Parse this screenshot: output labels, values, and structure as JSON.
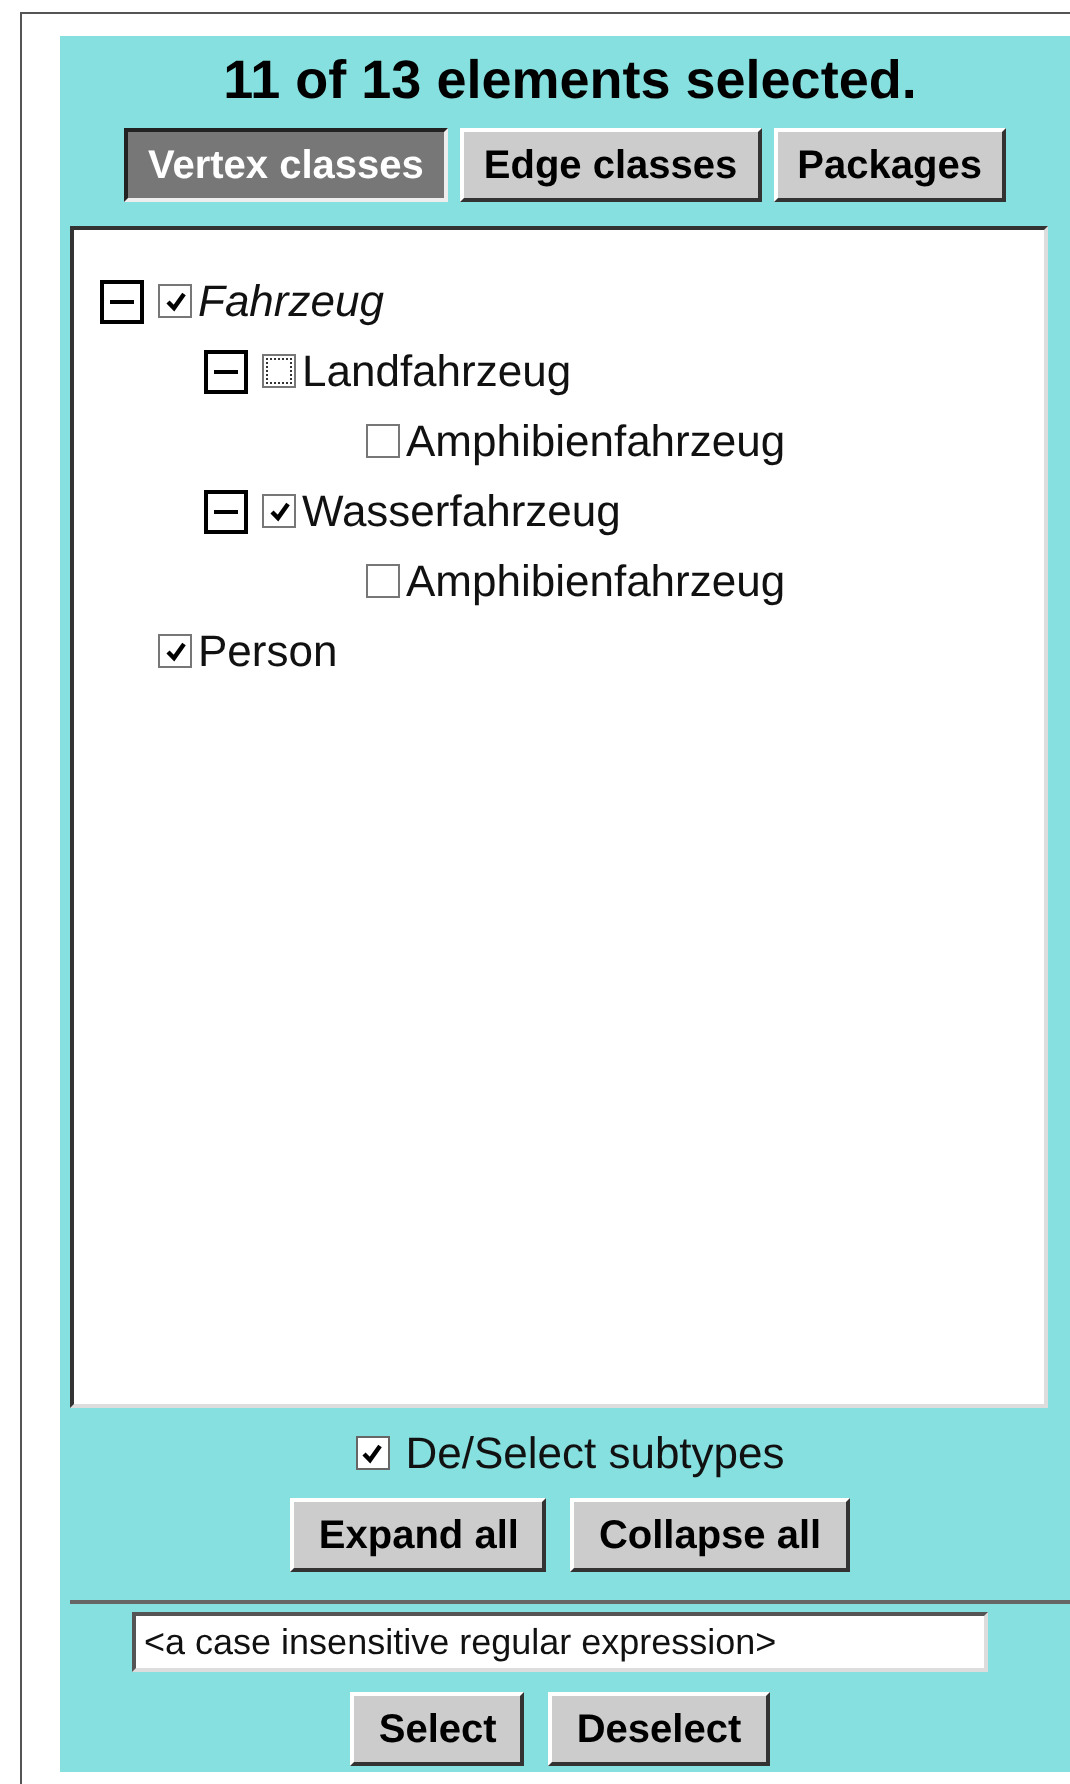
{
  "title": "11 of 13 elements selected.",
  "tabs": [
    {
      "label": "Vertex classes",
      "selected": true
    },
    {
      "label": "Edge classes",
      "selected": false
    },
    {
      "label": "Packages",
      "selected": false
    }
  ],
  "tree": [
    {
      "label": "Fahrzeug",
      "checked": true,
      "abstract": true,
      "focused": false,
      "expanded": true,
      "children": [
        {
          "label": "Landfahrzeug",
          "checked": false,
          "abstract": false,
          "focused": true,
          "expanded": true,
          "children": [
            {
              "label": "Amphibienfahrzeug",
              "checked": false,
              "abstract": false,
              "focused": false
            }
          ]
        },
        {
          "label": "Wasserfahrzeug",
          "checked": true,
          "abstract": false,
          "focused": false,
          "expanded": true,
          "children": [
            {
              "label": "Amphibienfahrzeug",
              "checked": false,
              "abstract": false,
              "focused": false
            }
          ]
        }
      ]
    },
    {
      "label": "Person",
      "checked": true,
      "abstract": false,
      "focused": false
    }
  ],
  "subtypes_option": {
    "label": "De/Select subtypes",
    "checked": true
  },
  "tree_buttons": [
    "Expand all",
    "Collapse all"
  ],
  "filter": {
    "value": "<a case insensitive regular expression>"
  },
  "filter_buttons": [
    "Select",
    "Deselect"
  ]
}
